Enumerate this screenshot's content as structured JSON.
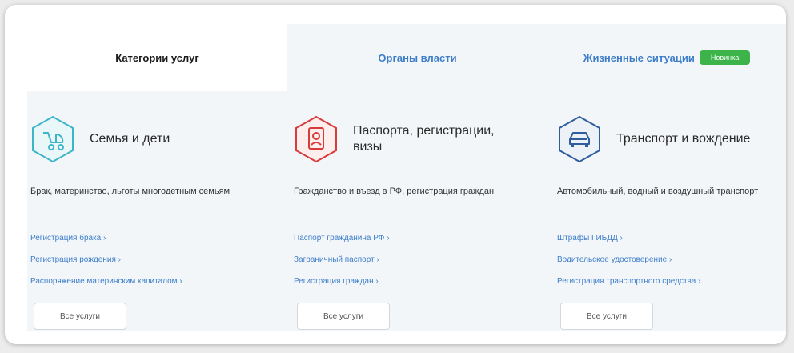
{
  "tabs": [
    {
      "label": "Категории услуг"
    },
    {
      "label": "Органы власти"
    },
    {
      "label": "Жизненные ситуации",
      "badge": "Новинка"
    }
  ],
  "categories": [
    {
      "icon": "stroller-icon",
      "title": "Семья и дети",
      "description": "Брак, материнство, льготы многодетным семьям",
      "links": [
        "Регистрация брака ›",
        "Регистрация рождения ›",
        "Распоряжение материнским капиталом ›"
      ],
      "button": "Все услуги"
    },
    {
      "icon": "passport-icon",
      "title": "Паспорта, регистрации, визы",
      "description": "Гражданство и въезд в РФ, регистрация граждан",
      "links": [
        "Паспорт гражданина РФ ›",
        "Заграничный паспорт ›",
        "Регистрация граждан ›"
      ],
      "button": "Все услуги"
    },
    {
      "icon": "car-icon",
      "title": "Транспорт и вождение",
      "description": "Автомобильный, водный и воздушный транспорт",
      "links": [
        "Штрафы ГИБДД ›",
        "Водительское удостоверение ›",
        "Регистрация транспортного средства ›"
      ],
      "button": "Все услуги"
    }
  ],
  "colors": {
    "accent_blue": "#3d7ec9",
    "teal": "#3fb5c8",
    "red": "#d93a3a",
    "navy": "#2f5e9e",
    "badge_green": "#3cb44a"
  }
}
